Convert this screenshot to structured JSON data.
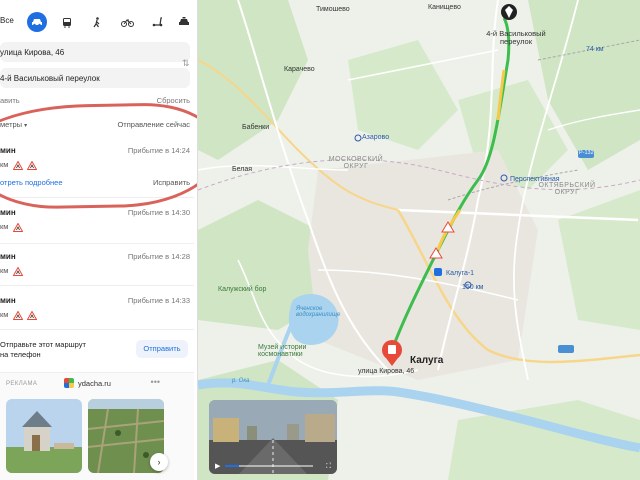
{
  "sidebar": {
    "mode_all": "Все",
    "from": "улица Кирова, 46",
    "to": "4-й Васильковый переулок",
    "add_point": "авить",
    "reset": "Сбросить",
    "filter_left": "метры",
    "filter_right": "Отправление сейчас",
    "routes": [
      {
        "time": "мин",
        "arrival": "Прибытие в 14:24",
        "dist": "км",
        "details": "отреть подробнее",
        "fix": "Исправить"
      },
      {
        "time": "мин",
        "arrival": "Прибытие в 14:30",
        "dist": "км"
      },
      {
        "time": "мин",
        "arrival": "Прибытие в 14:28",
        "dist": "км"
      },
      {
        "time": "мин",
        "arrival": "Прибытие в 14:33",
        "dist": "км"
      }
    ],
    "send_line1": "Отправьте этот маршрут",
    "send_line2": "на телефон",
    "send_button": "Отправить",
    "ad_tag": "РЕКЛАМА",
    "ad_site": "ydacha.ru",
    "ad_more": "•••",
    "ad_next": "›"
  },
  "modes": [
    "car-icon",
    "bus-icon",
    "walk-icon",
    "bike-icon",
    "scooter-icon",
    "taxi-icon"
  ],
  "map": {
    "labels": {
      "timoshevo": "Тимошево",
      "kanishchevo": "Канищево",
      "destination": "4-й Васильковый переулок",
      "karachevo": "Карачево",
      "babenki": "Бабенки",
      "belaya": "Белая",
      "azarovo": "Азарово",
      "moskovsky": "МОСКОВСКИЙ ОКРУГ",
      "oktyabrsky": "ОКТЯБРЬСКИЙ ОКРУГ",
      "perspektivnaya": "Перспективная",
      "kaluga1": "Калуга-1",
      "kaluga": "Калуга",
      "origin": "улица Кирова, 46",
      "kaluzhsky_bor": "Калужский бор",
      "museum": "Музей истории космонавтики",
      "yachenskoe": "Яченское водохранилище",
      "oka": "р. Ока",
      "r132": "Р-132",
      "km74": "74 км",
      "km150": "150 км"
    }
  },
  "pano": {
    "play": "▶",
    "fullscreen": "⛶",
    "progress": 0.16
  },
  "colors": {
    "accent": "#1f6fe0",
    "route_green": "#3dbd4d",
    "marker": "#e84a3a",
    "annotation": "#d9625a"
  }
}
